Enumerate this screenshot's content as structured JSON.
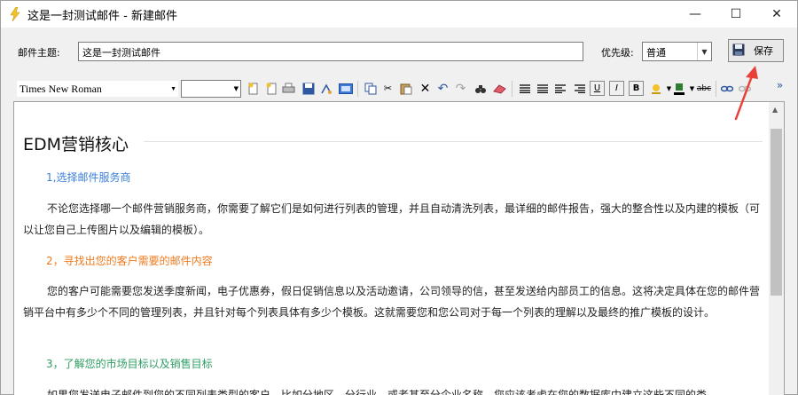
{
  "window": {
    "title": "这是一封测试邮件 - 新建邮件",
    "minimize": "—",
    "maximize": "☐",
    "close": "✕"
  },
  "form": {
    "subject_label": "邮件主题:",
    "subject_value": "这是一封测试邮件",
    "priority_label": "优先级:",
    "priority_value": "普通",
    "save_label": "保存"
  },
  "toolbar": {
    "font_name": "Times New Roman",
    "font_size": "",
    "more": "»",
    "underline": "U",
    "italic": "I",
    "bold": "B",
    "strike": "abc"
  },
  "document": {
    "heading": "EDM营销核心",
    "sections": [
      {
        "title": "1,选择邮件服务商",
        "color": "#3b7fd9",
        "body": "不论您选择哪一个邮件营销服务商，你需要了解它们是如何进行列表的管理，并且自动清洗列表，最详细的邮件报告，强大的整合性以及内建的模板（可以让您自己上传图片以及编辑的模板）。"
      },
      {
        "title": "2，寻找出您的客户需要的邮件内容",
        "color": "#f07a1e",
        "body": "您的客户可能需要您发送季度新闻，电子优惠券，假日促销信息以及活动邀请，公司领导的信，甚至发送给内部员工的信息。这将决定具体在您的邮件营销平台中有多少个不同的管理列表，并且针对每个列表具体有多少个模板。这就需要您和您公司对于每一个列表的理解以及最终的推广模板的设计。"
      },
      {
        "title": "3，了解您的市场目标以及销售目标",
        "color": "#2e9e63",
        "body": "如果您发送电子邮件到您的不同列表类型的客户，比如分地区，分行业，或者甚至分企业名称，您应该考虑在您的数据库中建立这些不同的类"
      }
    ]
  },
  "colors": {
    "annotation_arrow": "#e8413a"
  }
}
